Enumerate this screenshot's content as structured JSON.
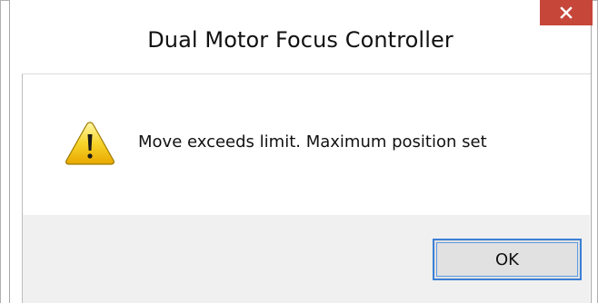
{
  "window": {
    "title": "Dual Motor Focus Controller",
    "close_icon": "close-icon",
    "close_color": "#c7463a"
  },
  "message": {
    "icon": "warning-icon",
    "text": "Move exceeds limit. Maximum position set"
  },
  "buttons": {
    "ok_label": "OK"
  }
}
